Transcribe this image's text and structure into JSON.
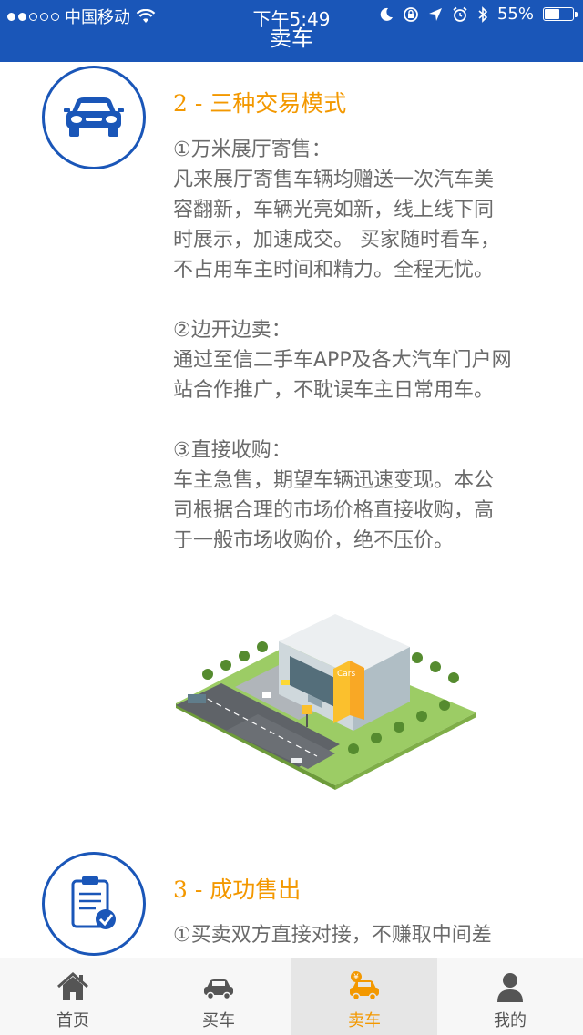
{
  "status_bar": {
    "carrier": "中国移动",
    "time": "下午5:49",
    "battery": "55%",
    "battery_level": 0.55
  },
  "header": {
    "title": "卖车"
  },
  "sections": [
    {
      "icon": "car-icon",
      "title": "2 - 三种交易模式",
      "paragraphs": [
        {
          "heading": "①万米展厅寄售：",
          "lines": [
            "凡来展厅寄售车辆均赠送一次汽车美",
            "容翻新，车辆光亮如新，线上线下同",
            "时展示，加速成交。 买家随时看车，",
            "不占用车主时间和精力。全程无忧。"
          ]
        },
        {
          "heading": "②边开边卖：",
          "lines": [
            "通过至信二手车APP及各大汽车门户网",
            "站合作推广，不耽误车主日常用车。"
          ]
        },
        {
          "heading": "③直接收购：",
          "lines": [
            "车主急售，期望车辆迅速变现。本公",
            "司根据合理的市场价格直接收购，高",
            "于一般市场收购价，绝不压价。"
          ]
        }
      ]
    },
    {
      "icon": "clipboard-check-icon",
      "title": "3 - 成功售出",
      "paragraphs": [
        {
          "heading": "",
          "lines": [
            "①买卖双方直接对接，不赚取中间差"
          ]
        }
      ]
    }
  ],
  "illustration": {
    "sign_text": "Cars"
  },
  "tabbar": {
    "items": [
      {
        "label": "首页",
        "icon": "home-icon",
        "active": false
      },
      {
        "label": "买车",
        "icon": "car-icon",
        "active": false
      },
      {
        "label": "卖车",
        "icon": "sell-car-icon",
        "active": true
      },
      {
        "label": "我的",
        "icon": "user-icon",
        "active": false
      }
    ]
  },
  "colors": {
    "primary": "#1a56b8",
    "accent": "#f39800",
    "text": "#6a6a6a"
  }
}
